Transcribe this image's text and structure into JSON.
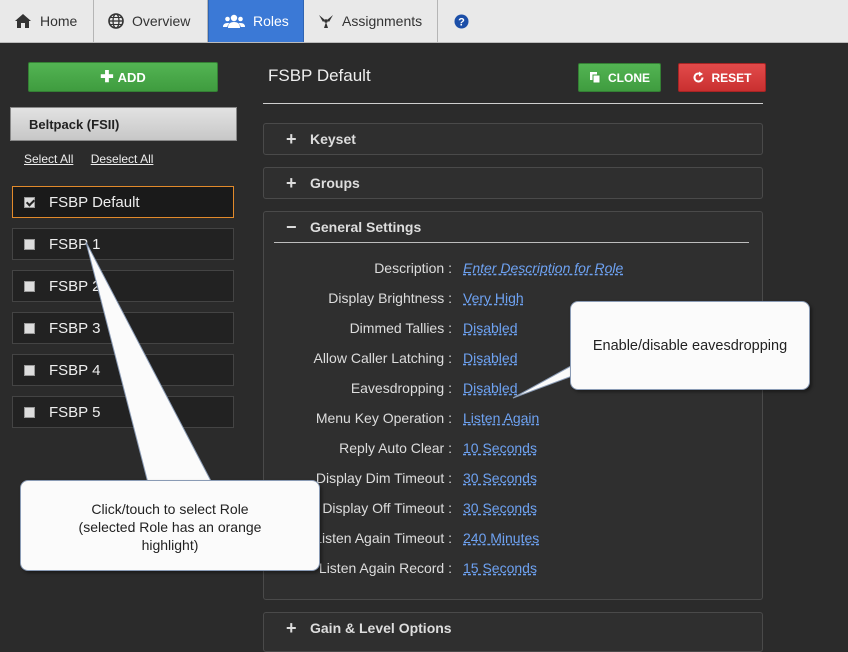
{
  "nav": {
    "tabs": [
      {
        "label": "Home",
        "icon": "home-icon"
      },
      {
        "label": "Overview",
        "icon": "globe-icon"
      },
      {
        "label": "Roles",
        "icon": "users-icon",
        "active": true
      },
      {
        "label": "Assignments",
        "icon": "assignments-icon"
      }
    ],
    "help_icon": "help-icon"
  },
  "sidebar": {
    "add_label": "ADD",
    "device_type": "Beltpack (FSII)",
    "select_all": "Select All",
    "deselect_all": "Deselect All",
    "roles": [
      {
        "label": "FSBP Default",
        "selected": true
      },
      {
        "label": "FSBP 1",
        "selected": false
      },
      {
        "label": "FSBP 2",
        "selected": false
      },
      {
        "label": "FSBP 3",
        "selected": false
      },
      {
        "label": "FSBP 4",
        "selected": false
      },
      {
        "label": "FSBP 5",
        "selected": false
      }
    ]
  },
  "main": {
    "title": "FSBP Default",
    "clone_label": "CLONE",
    "reset_label": "RESET",
    "sections": {
      "keyset": "Keyset",
      "groups": "Groups",
      "general": "General Settings",
      "gain": "Gain & Level Options"
    },
    "settings": [
      {
        "label": "Description :",
        "value": "Enter Description for Role"
      },
      {
        "label": "Display Brightness :",
        "value": "Very High"
      },
      {
        "label": "Dimmed Tallies :",
        "value": "Disabled"
      },
      {
        "label": "Allow Caller Latching :",
        "value": "Disabled"
      },
      {
        "label": "Eavesdropping :",
        "value": "Disabled"
      },
      {
        "label": "Menu Key Operation :",
        "value": "Listen Again"
      },
      {
        "label": "Reply Auto Clear :",
        "value": "10 Seconds"
      },
      {
        "label": "Display Dim Timeout :",
        "value": "30 Seconds"
      },
      {
        "label": "Display Off Timeout :",
        "value": "30 Seconds"
      },
      {
        "label": "Listen Again Timeout :",
        "value": "240 Minutes"
      },
      {
        "label": "Listen Again Record :",
        "value": "15 Seconds"
      }
    ]
  },
  "callouts": {
    "eavesdrop": "Enable/disable eavesdropping",
    "select_role_line1": "Click/touch to select Role",
    "select_role_line2": "(selected Role has an orange",
    "select_role_line3": "highlight)"
  },
  "colors": {
    "accent": "#3b79d6",
    "add_green": "#4aa84a",
    "reset_red": "#d63a3a",
    "selected_orange": "#e28a2b",
    "link_blue": "#6ea2f2"
  }
}
